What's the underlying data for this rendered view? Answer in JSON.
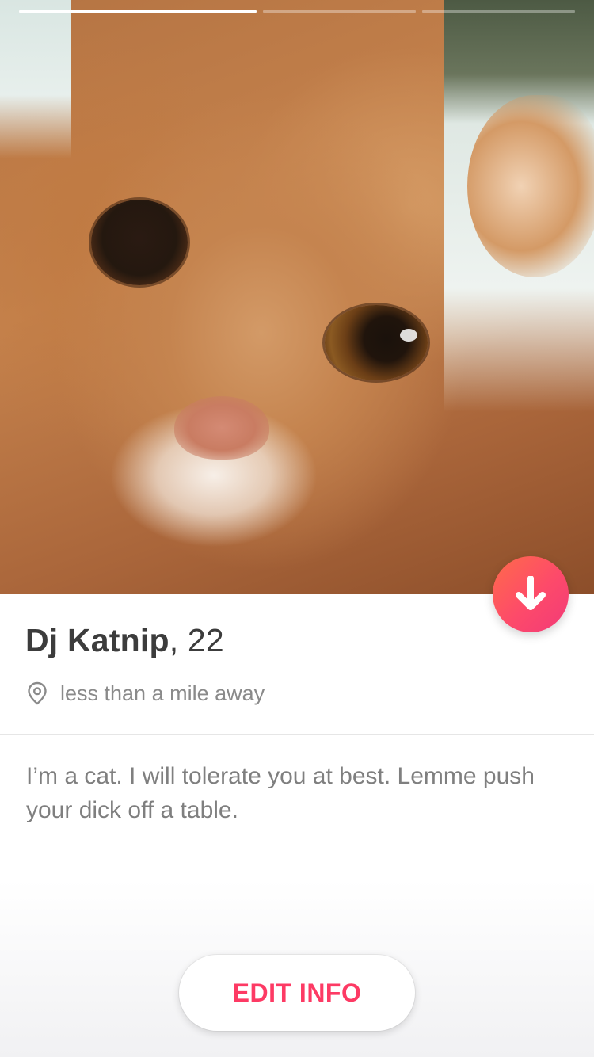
{
  "profile": {
    "name": "Dj Katnip",
    "age_text": ", 22",
    "distance": "less than a mile away",
    "bio": "I’m a cat. I will tolerate you at best. Lemme push your dick off a table.",
    "photo_description": "orange tabby cat close-up"
  },
  "photos": {
    "count": 3,
    "active_index": 0
  },
  "actions": {
    "edit_label": "EDIT INFO",
    "collapse_icon": "arrow-down-icon"
  },
  "colors": {
    "accent": "#fd3a64",
    "gradient_start": "#ff6b4a",
    "gradient_end": "#f23a78",
    "name_text": "#3c3c3c",
    "secondary_text": "#8a8a8a"
  }
}
